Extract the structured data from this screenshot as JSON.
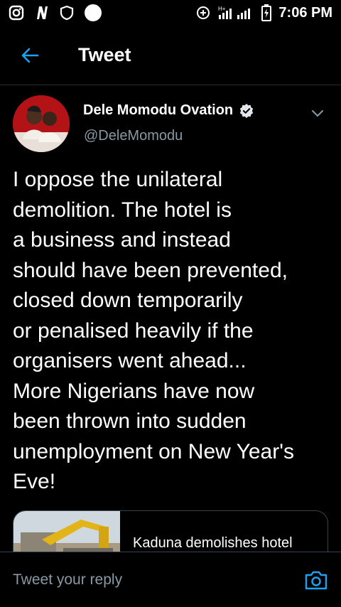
{
  "status_bar": {
    "time": "7:06 PM",
    "left_icons": [
      "instagram-icon",
      "n-app-icon",
      "shield-icon",
      "circle-icon"
    ],
    "right_icons": [
      "data-saver-icon",
      "signal-icon",
      "battery-charging-icon"
    ],
    "network_label": "H+"
  },
  "header": {
    "back_icon": "arrow-left-icon",
    "title": "Tweet"
  },
  "tweet": {
    "author_name": "Dele Momodu Ovation",
    "handle": "@DeleMomodu",
    "verified": true,
    "text": "I oppose the unilateral demolition. The hotel is a business and instead should have been prevented, closed down temporarily or penalised heavily if the organisers went ahead... More Nigerians have now been thrown into sudden unemployment on New Year's Eve!",
    "lines": [
      "I oppose the unilateral",
      "demolition. The hotel is",
      "a business and instead",
      "should have been prevented,",
      "closed down temporarily",
      "or penalised heavily if the",
      "organisers went ahead...",
      "More Nigerians have now",
      "been thrown into sudden",
      "unemployment on New Year's",
      "Eve!"
    ],
    "card_title": "Kaduna demolishes hotel"
  },
  "reply": {
    "placeholder": "Tweet your reply",
    "camera_icon": "camera-icon"
  },
  "colors": {
    "background": "#000000",
    "accent": "#1da1f2",
    "secondary_text": "#8899a6",
    "divider": "#38444d"
  }
}
